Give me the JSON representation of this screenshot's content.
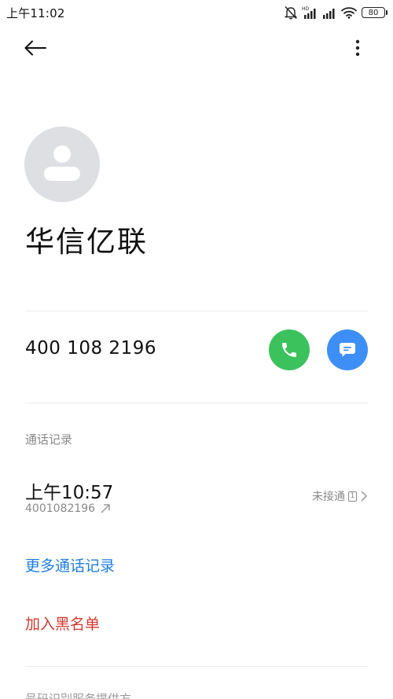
{
  "status_bar": {
    "time": "上午11:02",
    "battery": "80",
    "signal_badge": "HD",
    "icons": [
      "mute-bell-icon",
      "hd-signal-icon",
      "signal-icon",
      "wifi-icon",
      "battery-icon"
    ]
  },
  "app_bar": {
    "back_icon": "arrow-left-icon",
    "menu_icon": "more-vertical-icon"
  },
  "contact": {
    "name": "华信亿联",
    "avatar_icon": "default-person-avatar"
  },
  "phone": {
    "number": "400 108 2196",
    "call_icon": "phone-icon",
    "call_color": "#3cc25c",
    "message_icon": "chat-bubble-icon",
    "message_color": "#3d8ff5"
  },
  "call_log": {
    "section_title": "通话记录",
    "records": [
      {
        "time": "上午10:57",
        "number": "4001082196",
        "direction_icon": "outgoing-arrow-icon",
        "status": "未接通",
        "sim": "1"
      }
    ]
  },
  "actions": {
    "more_records": "更多通话记录",
    "more_records_color": "#1f7ee0",
    "add_blacklist": "加入黑名单",
    "add_blacklist_color": "#d23a2f"
  },
  "footer": {
    "partial_text": "号码识别服务提供方"
  }
}
